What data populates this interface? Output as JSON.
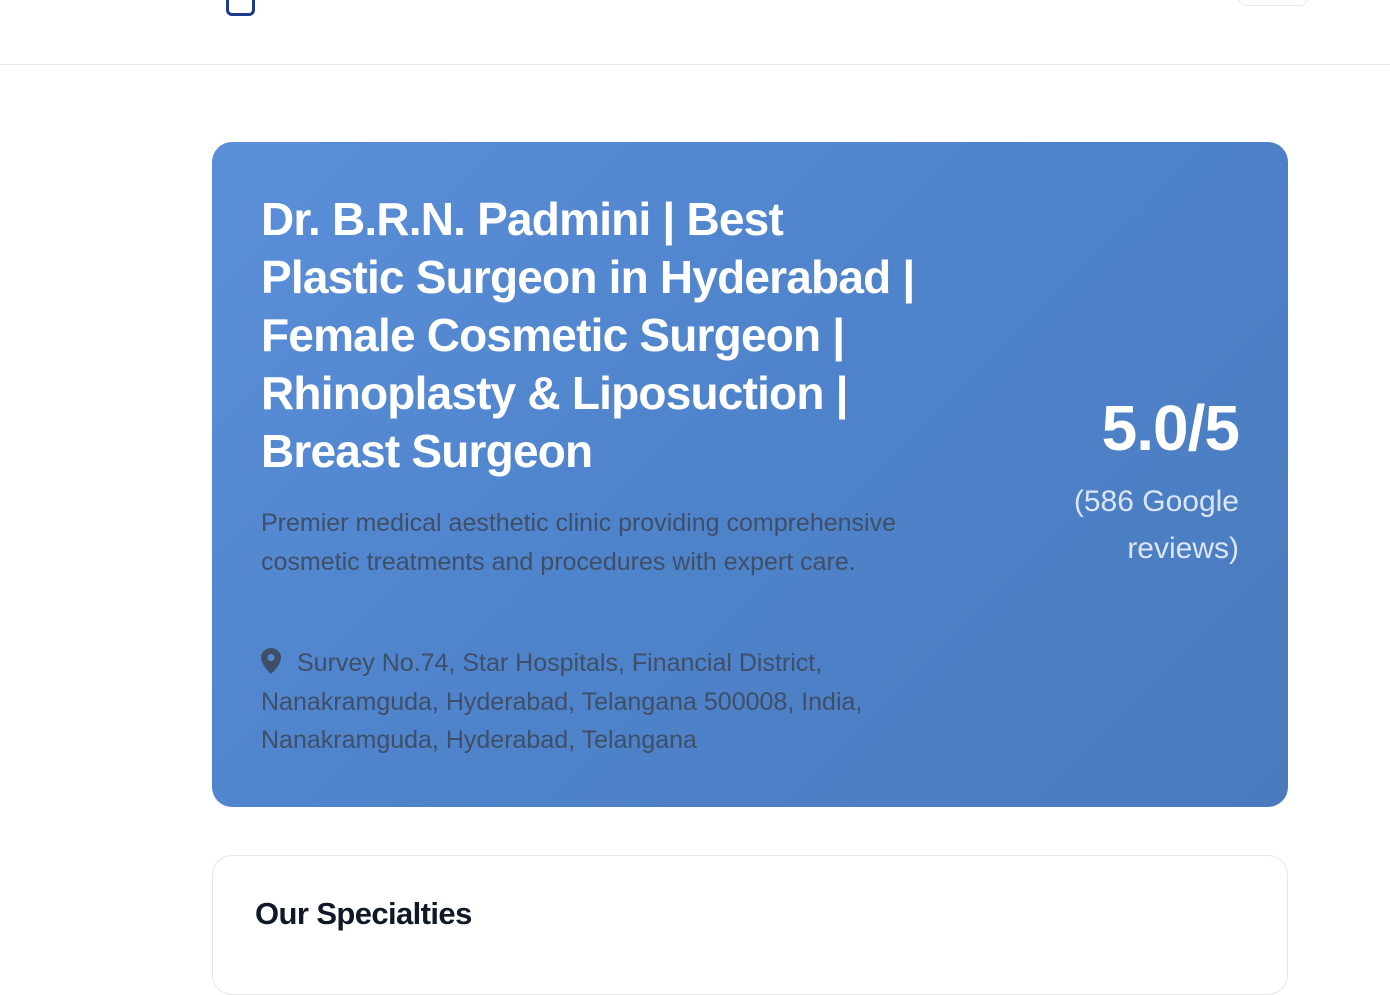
{
  "header": {
    "logo_icon": "clinic-logo-icon",
    "menu_button_label": ""
  },
  "hero": {
    "title": "Dr. B.R.N. Padmini | Best Plastic Surgeon in Hyderabad | Female Cosmetic Surgeon | Rhinoplasty & Liposuction | Breast Surgeon",
    "description": "Premier medical aesthetic clinic providing comprehensive cosmetic treatments and procedures with expert care.",
    "address_icon": "map-pin-icon",
    "address": "Survey No.74, Star Hospitals, Financial District, Nanakramguda, Hyderabad, Telangana 500008, India, Nanakramguda, Hyderabad, Telangana",
    "rating_score": "5.0/5",
    "rating_count": "(586 Google reviews)"
  },
  "specialties": {
    "title": "Our Specialties"
  },
  "colors": {
    "hero_gradient_start": "#5b8fd9",
    "hero_gradient_end": "#4a7abd",
    "muted_text": "#3e4f67",
    "heading_dark": "#111827",
    "logo_accent": "#1e3a8a"
  }
}
